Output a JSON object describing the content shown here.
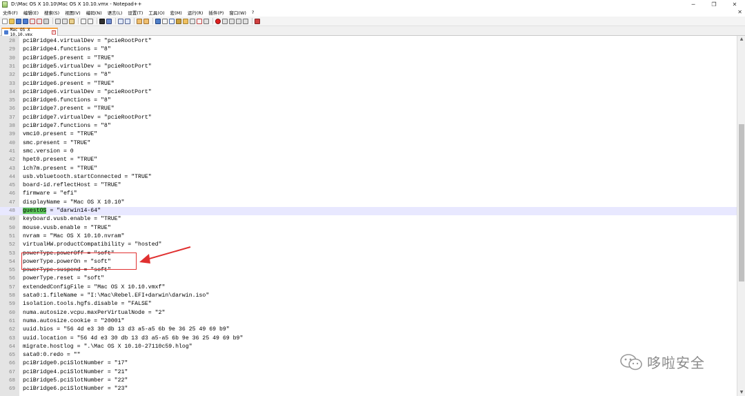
{
  "window": {
    "title": "D:\\Mac OS X 10.10\\Mac OS X 10.10.vmx - Notepad++",
    "controls": [
      "─",
      "❐",
      "✕"
    ]
  },
  "menu": {
    "items": [
      "文件(F)",
      "编辑(E)",
      "搜索(S)",
      "视图(V)",
      "编码(N)",
      "语言(L)",
      "设置(T)",
      "工具(O)",
      "宏(M)",
      "运行(R)",
      "插件(P)",
      "窗口(W)",
      "?"
    ],
    "close": "✕"
  },
  "tab": {
    "label": "Mac OS X 10.10.vmx"
  },
  "editor": {
    "lines": [
      {
        "n": "28",
        "text": "pciBridge4.virtualDev = \"pcieRootPort\""
      },
      {
        "n": "29",
        "text": "pciBridge4.functions = \"8\""
      },
      {
        "n": "30",
        "text": "pciBridge5.present = \"TRUE\""
      },
      {
        "n": "31",
        "text": "pciBridge5.virtualDev = \"pcieRootPort\""
      },
      {
        "n": "32",
        "text": "pciBridge5.functions = \"8\""
      },
      {
        "n": "33",
        "text": "pciBridge6.present = \"TRUE\""
      },
      {
        "n": "34",
        "text": "pciBridge6.virtualDev = \"pcieRootPort\""
      },
      {
        "n": "35",
        "text": "pciBridge6.functions = \"8\""
      },
      {
        "n": "36",
        "text": "pciBridge7.present = \"TRUE\""
      },
      {
        "n": "37",
        "text": "pciBridge7.virtualDev = \"pcieRootPort\""
      },
      {
        "n": "38",
        "text": "pciBridge7.functions = \"8\""
      },
      {
        "n": "39",
        "text": "vmci0.present = \"TRUE\""
      },
      {
        "n": "40",
        "text": "smc.present = \"TRUE\""
      },
      {
        "n": "41",
        "text": "smc.version = 0"
      },
      {
        "n": "42",
        "text": "hpet0.present = \"TRUE\""
      },
      {
        "n": "43",
        "text": "ich7m.present = \"TRUE\""
      },
      {
        "n": "44",
        "text": "usb.vbluetooth.startConnected = \"TRUE\""
      },
      {
        "n": "45",
        "text": "board-id.reflectHost = \"TRUE\""
      },
      {
        "n": "46",
        "text": "firmware = \"efi\""
      },
      {
        "n": "47",
        "text": "displayName = \"Mac OS X 10.10\""
      },
      {
        "n": "48",
        "text": " = \"darwin14-64\"",
        "highlight": "guestOS"
      },
      {
        "n": "49",
        "text": "keyboard.vusb.enable = \"TRUE\""
      },
      {
        "n": "50",
        "text": "mouse.vusb.enable = \"TRUE\""
      },
      {
        "n": "51",
        "text": "nvram = \"Mac OS X 10.10.nvram\""
      },
      {
        "n": "52",
        "text": "virtualHW.productCompatibility = \"hosted\""
      },
      {
        "n": "53",
        "text": "powerType.powerOff = \"soft\""
      },
      {
        "n": "54",
        "text": "powerType.powerOn = \"soft\""
      },
      {
        "n": "55",
        "text": "powerType.suspend = \"soft\""
      },
      {
        "n": "56",
        "text": "powerType.reset = \"soft\""
      },
      {
        "n": "57",
        "text": "extendedConfigFile = \"Mac OS X 10.10.vmxf\""
      },
      {
        "n": "58",
        "text": "sata0:1.fileName = \"I:\\Mac\\Rebel.EFI+darwin\\darwin.iso\""
      },
      {
        "n": "59",
        "text": "isolation.tools.hgfs.disable = \"FALSE\""
      },
      {
        "n": "60",
        "text": "numa.autosize.vcpu.maxPerVirtualNode = \"2\""
      },
      {
        "n": "61",
        "text": "numa.autosize.cookie = \"20001\""
      },
      {
        "n": "62",
        "text": "uuid.bios = \"56 4d e3 30 db 13 d3 a5-a5 6b 9e 36 25 49 69 b9\""
      },
      {
        "n": "63",
        "text": "uuid.location = \"56 4d e3 30 db 13 d3 a5-a5 6b 9e 36 25 49 69 b9\""
      },
      {
        "n": "64",
        "text": "migrate.hostlog = \".\\Mac OS X 10.10-27110c59.hlog\""
      },
      {
        "n": "65",
        "text": "sata0:0.redo = \"\""
      },
      {
        "n": "66",
        "text": "pciBridge0.pciSlotNumber = \"17\""
      },
      {
        "n": "67",
        "text": "pciBridge4.pciSlotNumber = \"21\""
      },
      {
        "n": "68",
        "text": "pciBridge5.pciSlotNumber = \"22\""
      },
      {
        "n": "69",
        "text": "pciBridge6.pciSlotNumber = \"23\""
      }
    ],
    "current_line": "48"
  },
  "watermark": {
    "text": "哆啦安全"
  },
  "colors": {
    "accent_tab": "#f9a23b",
    "annotation": "#e03030",
    "highlight": "#5ec85e",
    "current_line": "#e8e8ff"
  }
}
